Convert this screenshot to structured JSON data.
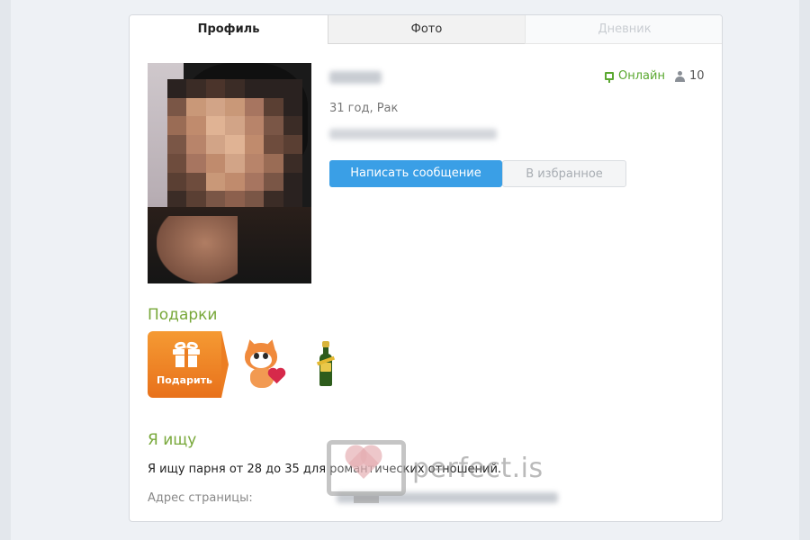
{
  "tabs": {
    "profile": "Профиль",
    "photo": "Фото",
    "diary": "Дневник"
  },
  "profile": {
    "status": "Онлайн",
    "viewers_count": "10",
    "age_sign": "31 год, Рак",
    "colors": {
      "online": "#5aa830",
      "accent": "#3a9fe6"
    }
  },
  "actions": {
    "message_label": "Написать сообщение",
    "favorite_label": "В избранное"
  },
  "gifts": {
    "heading": "Подарки",
    "give_label": "Подарить",
    "items": [
      "cat-with-heart-icon",
      "champagne-bottle-icon"
    ]
  },
  "seeking": {
    "heading": "Я ищу",
    "text": "Я ищу парня от 28 до 35 для романтических отношений.",
    "address_label": "Адрес страницы:"
  },
  "watermark": {
    "text": "perfect.is"
  }
}
